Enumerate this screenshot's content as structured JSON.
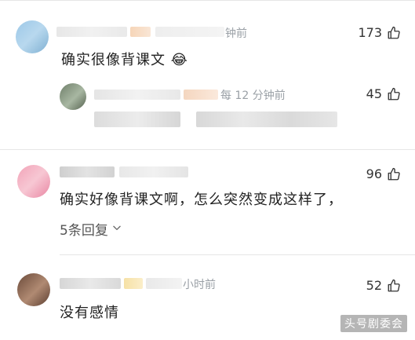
{
  "comments": [
    {
      "meta": "钟前",
      "text": "确实很像背课文",
      "emoji": "😂",
      "likes": "173"
    },
    {
      "meta": "每 12 分钟前",
      "text": "",
      "likes": "45"
    },
    {
      "meta": "",
      "text": "确实好像背课文啊，怎么突然变成这样了，",
      "likes": "96",
      "replies_label": "5条回复"
    },
    {
      "meta": "小时前",
      "text": "没有感情",
      "likes": "52"
    }
  ],
  "watermark": "头号剧委会",
  "colors": {
    "text": "#222222",
    "meta": "#9aa0a6",
    "divider": "#e6e6e6"
  },
  "icons": {
    "like": "thumbs-up-icon",
    "expand": "chevron-down-icon"
  }
}
